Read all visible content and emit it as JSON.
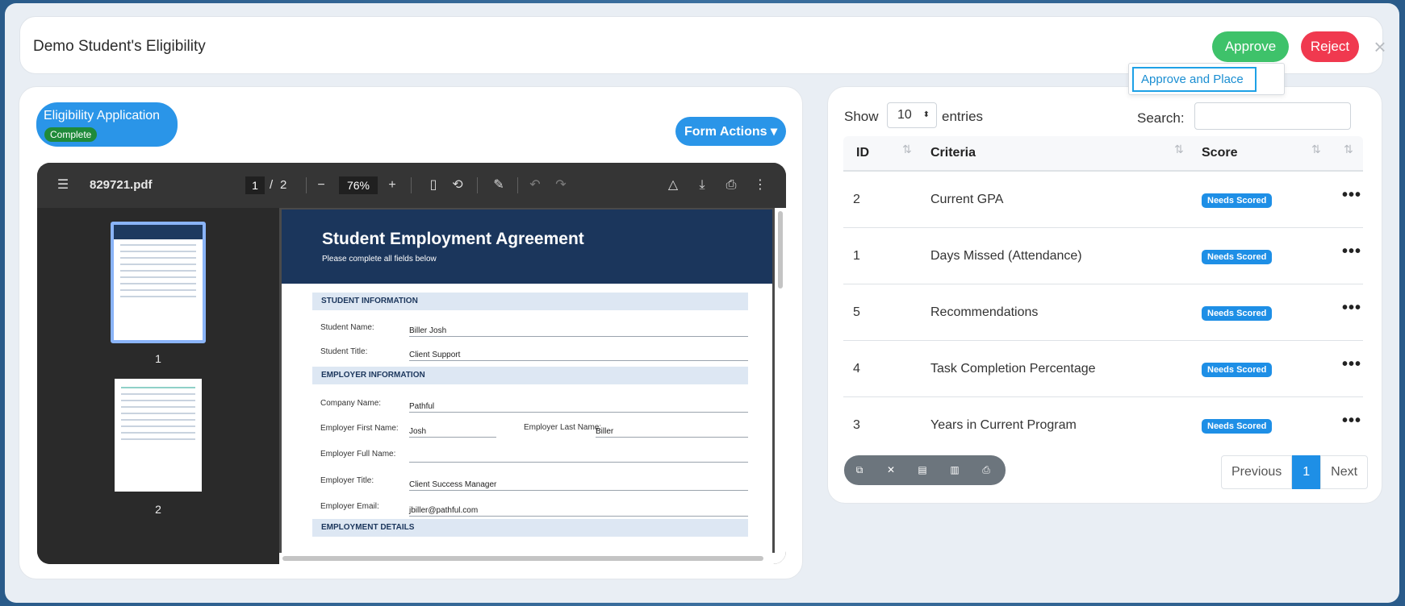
{
  "header": {
    "title": "Demo Student's Eligibility",
    "approve_label": "Approve",
    "reject_label": "Reject",
    "close_glyph": "×",
    "dropdown_item": "Approve and Place"
  },
  "application": {
    "title": "Eligibility Application",
    "status": "Complete",
    "form_actions_label": "Form Actions ▾"
  },
  "pdf_viewer": {
    "filename": "829721.pdf",
    "current_page": "1",
    "page_sep": "/",
    "total_pages": "2",
    "zoom": "76%",
    "thumbnails": [
      {
        "label": "1"
      },
      {
        "label": "2"
      }
    ],
    "document": {
      "title": "Student Employment Agreement",
      "subtitle": "Please complete all fields below",
      "sections": {
        "student": "STUDENT INFORMATION",
        "employer": "EMPLOYER INFORMATION",
        "employment": "EMPLOYMENT DETAILS"
      },
      "fields": {
        "student_name_label": "Student Name:",
        "student_name_value": "Biller Josh",
        "student_title_label": "Student Title:",
        "student_title_value": "Client Support",
        "company_label": "Company Name:",
        "company_value": "Pathful",
        "emp_first_label": "Employer First Name:",
        "emp_first_value": "Josh",
        "emp_last_label": "Employer Last Name:",
        "emp_last_value": "Biller",
        "emp_full_label": "Employer Full Name:",
        "emp_title_label": "Employer Title:",
        "emp_title_value": "Client Success Manager",
        "emp_email_label": "Employer Email:",
        "emp_email_value": "jbiller@pathful.com"
      }
    }
  },
  "table_controls": {
    "show_label": "Show",
    "entries_value": "10",
    "entries_label": "entries",
    "search_label": "Search:"
  },
  "table": {
    "columns": [
      "ID",
      "Criteria",
      "Score"
    ],
    "rows": [
      {
        "id": "2",
        "criteria": "Current GPA",
        "score": "Needs Scored"
      },
      {
        "id": "1",
        "criteria": "Days Missed (Attendance)",
        "score": "Needs Scored"
      },
      {
        "id": "5",
        "criteria": "Recommendations",
        "score": "Needs Scored"
      },
      {
        "id": "4",
        "criteria": "Task Completion Percentage",
        "score": "Needs Scored"
      },
      {
        "id": "3",
        "criteria": "Years in Current Program",
        "score": "Needs Scored"
      }
    ]
  },
  "pagination": {
    "previous": "Previous",
    "current": "1",
    "next": "Next"
  },
  "export_icons": [
    "copy-icon",
    "excel-icon",
    "csv-icon",
    "pdf-icon",
    "print-icon"
  ],
  "colors": {
    "approve": "#3ec26a",
    "reject": "#f0394f",
    "primary": "#2a95e8",
    "complete": "#1f8a3a",
    "doc_header": "#1b365c"
  }
}
